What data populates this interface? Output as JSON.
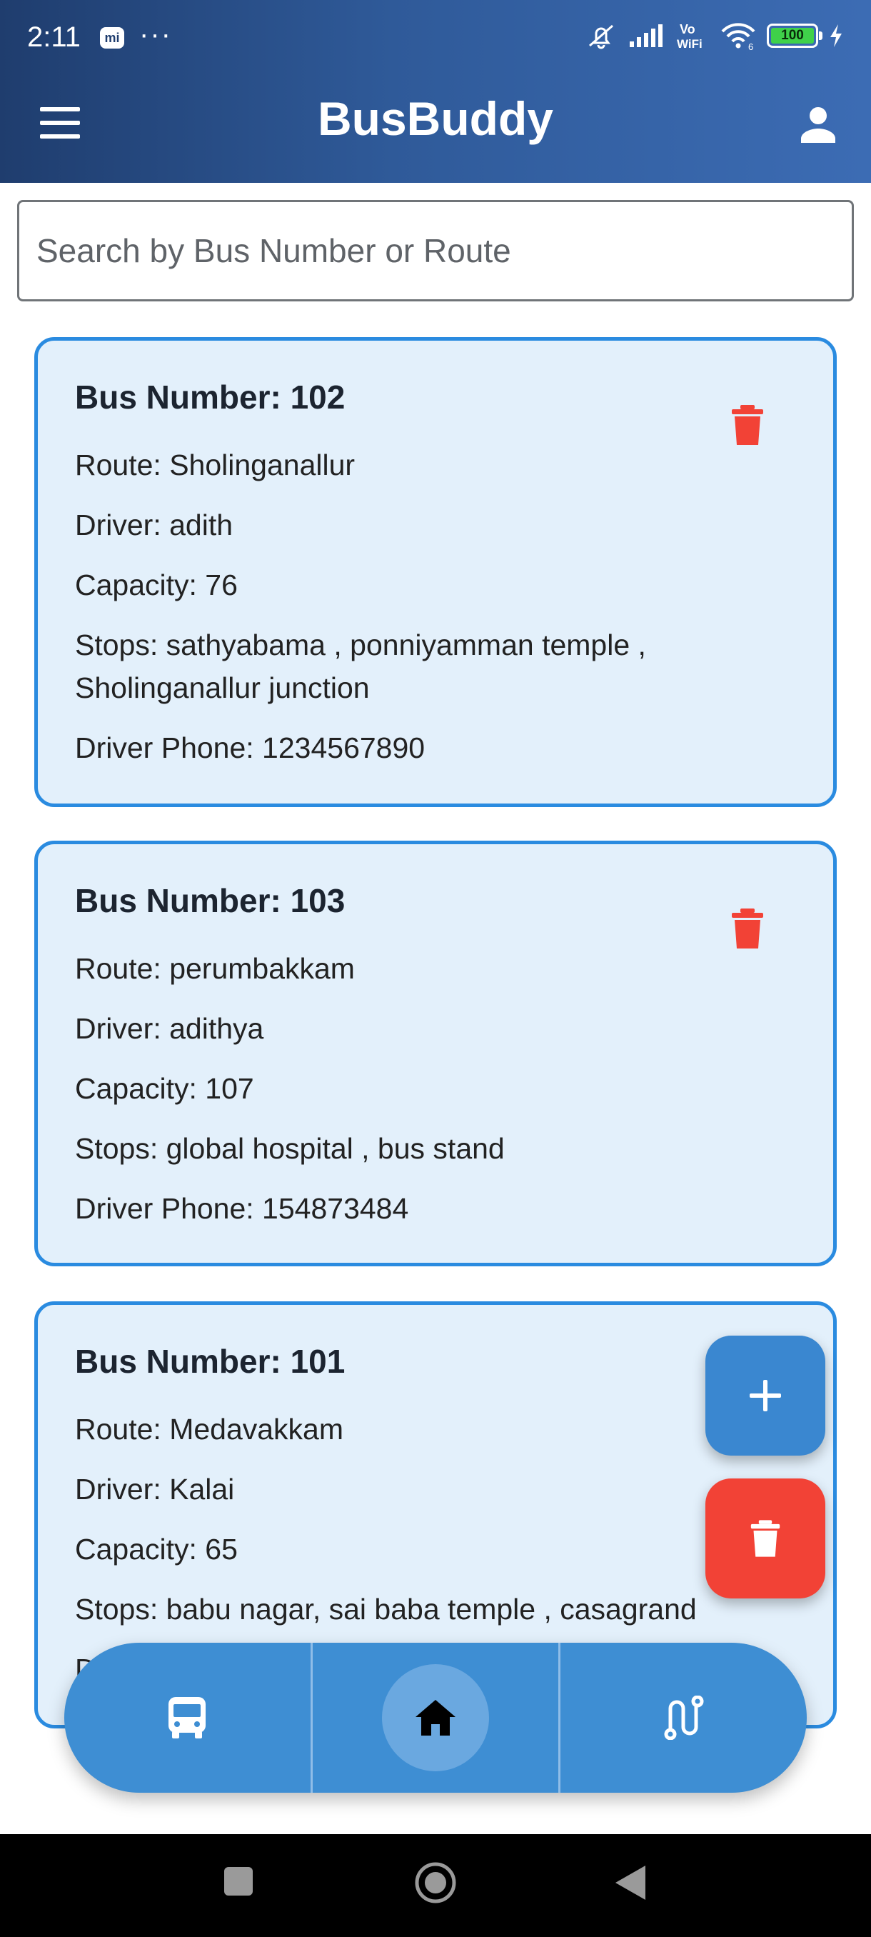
{
  "status_bar": {
    "time": "2:11",
    "mi_label": "mi",
    "more": "···",
    "vowifi_top": "Vo",
    "vowifi_bottom": "WiFi",
    "wifi_sub": "6",
    "battery_level": "100",
    "icons": [
      "notifications-muted-icon",
      "cell-signal-icon",
      "vowifi-icon",
      "wifi-icon",
      "battery-icon",
      "charging-icon"
    ]
  },
  "app_bar": {
    "title": "BusBuddy",
    "menu_icon": "hamburger-menu-icon",
    "profile_icon": "person-icon"
  },
  "search": {
    "placeholder": "Search by Bus Number or Route",
    "value": ""
  },
  "buses": [
    {
      "bus_number": "Bus Number: 102",
      "route": "Route: Sholinganallur",
      "driver": "Driver: adith",
      "capacity": "Capacity: 76",
      "stops_line1": "Stops: sathyabama , ponniyamman temple ,",
      "stops_line2": "Sholinganallur junction",
      "driver_phone": "Driver Phone: 1234567890"
    },
    {
      "bus_number": "Bus Number: 103",
      "route": "Route: perumbakkam",
      "driver": "Driver: adithya",
      "capacity": "Capacity: 107",
      "stops": "Stops: global hospital , bus stand",
      "driver_phone": "Driver Phone: 154873484"
    },
    {
      "bus_number": "Bus Number: 101",
      "route": "Route: Medavakkam",
      "driver": "Driver: Kalai",
      "capacity": "Capacity: 65",
      "stops": "Stops: babu nagar, sai baba temple , casagrand",
      "driver_phone_partial": "D"
    }
  ],
  "fabs": {
    "add_icon": "plus-icon",
    "delete_icon": "trash-icon"
  },
  "bottom_nav": {
    "tabs": [
      "bus-icon",
      "home-icon",
      "route-icon"
    ],
    "active": "home-icon"
  },
  "system_nav": [
    "recents-square-icon",
    "home-circle-icon",
    "back-triangle-icon"
  ],
  "colors": {
    "appbar_gradient_start": "#1f3d6e",
    "appbar_gradient_end": "#3c6cb4",
    "card_bg": "#e3f0fb",
    "card_border": "#2a8be0",
    "delete_red": "#f24236",
    "nav_blue": "#3e8ed3"
  }
}
